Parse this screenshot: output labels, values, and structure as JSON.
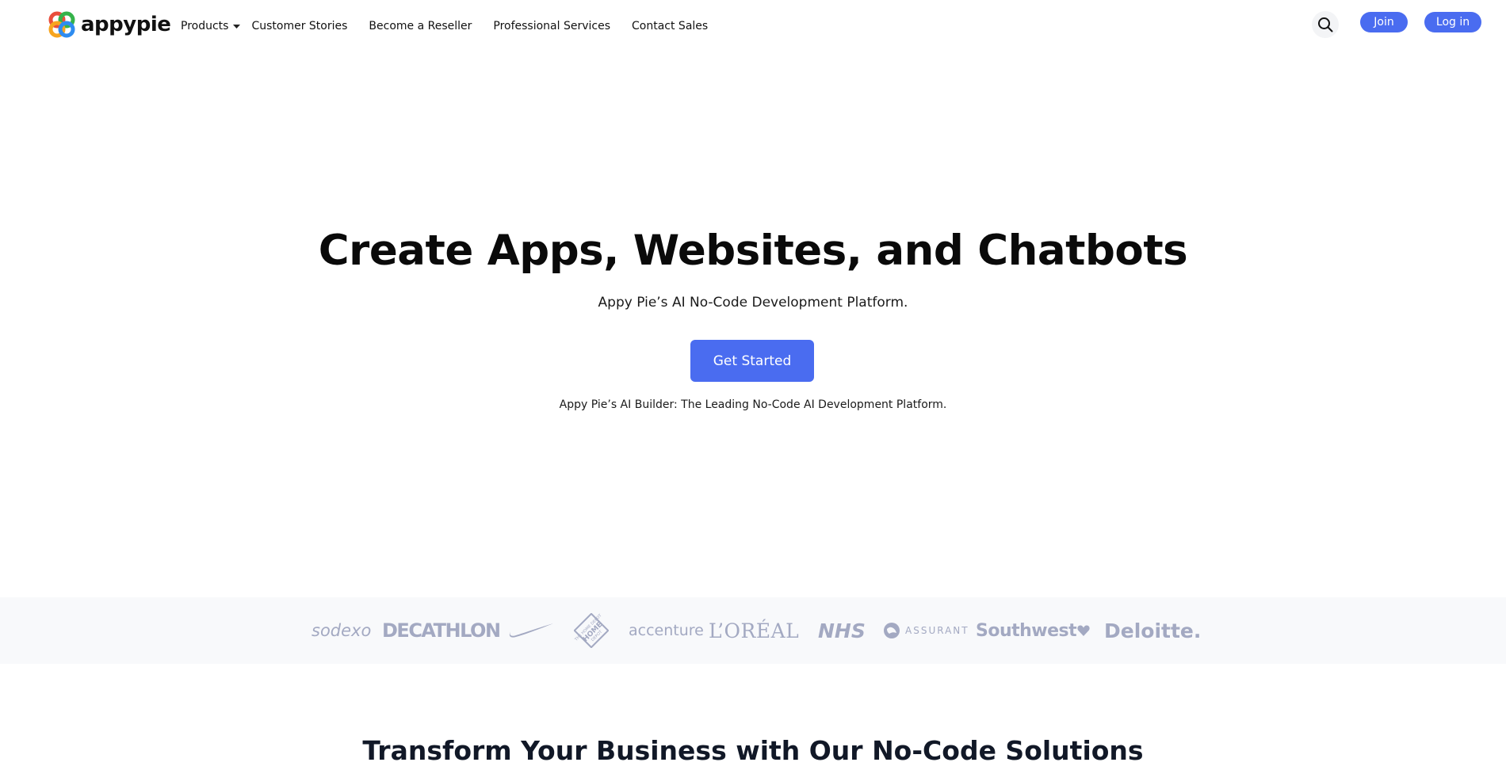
{
  "header": {
    "logo_text": "appypie",
    "nav": {
      "products": "Products",
      "customer_stories": "Customer Stories",
      "become_reseller": "Become a Reseller",
      "professional_services": "Professional Services",
      "contact_sales": "Contact Sales"
    },
    "join_label": "Join",
    "login_label": "Log in"
  },
  "hero": {
    "title": "Create Apps, Websites, and Chatbots",
    "subtitle": "Appy Pie’s AI No-Code Development Platform.",
    "cta_label": "Get Started",
    "note": "Appy Pie’s AI Builder: The Leading No-Code AI Development Platform."
  },
  "logos": {
    "sodexo": "sodexo",
    "decathlon": "DECATHLON",
    "nike": "nike-swoosh",
    "home_depot": "THE HOME DEPOT",
    "accenture": "accenture",
    "loreal": "L’ORÉAL",
    "nhs": "NHS",
    "assurant": "ASSURANT",
    "southwest": "Southwest",
    "deloitte": "Deloitte."
  },
  "section": {
    "heading": "Transform Your Business with Our No-Code Solutions"
  },
  "colors": {
    "accent": "#4a6cf0",
    "logo_gray": "#a3a9c2",
    "strip_bg": "#f8f9fb"
  }
}
